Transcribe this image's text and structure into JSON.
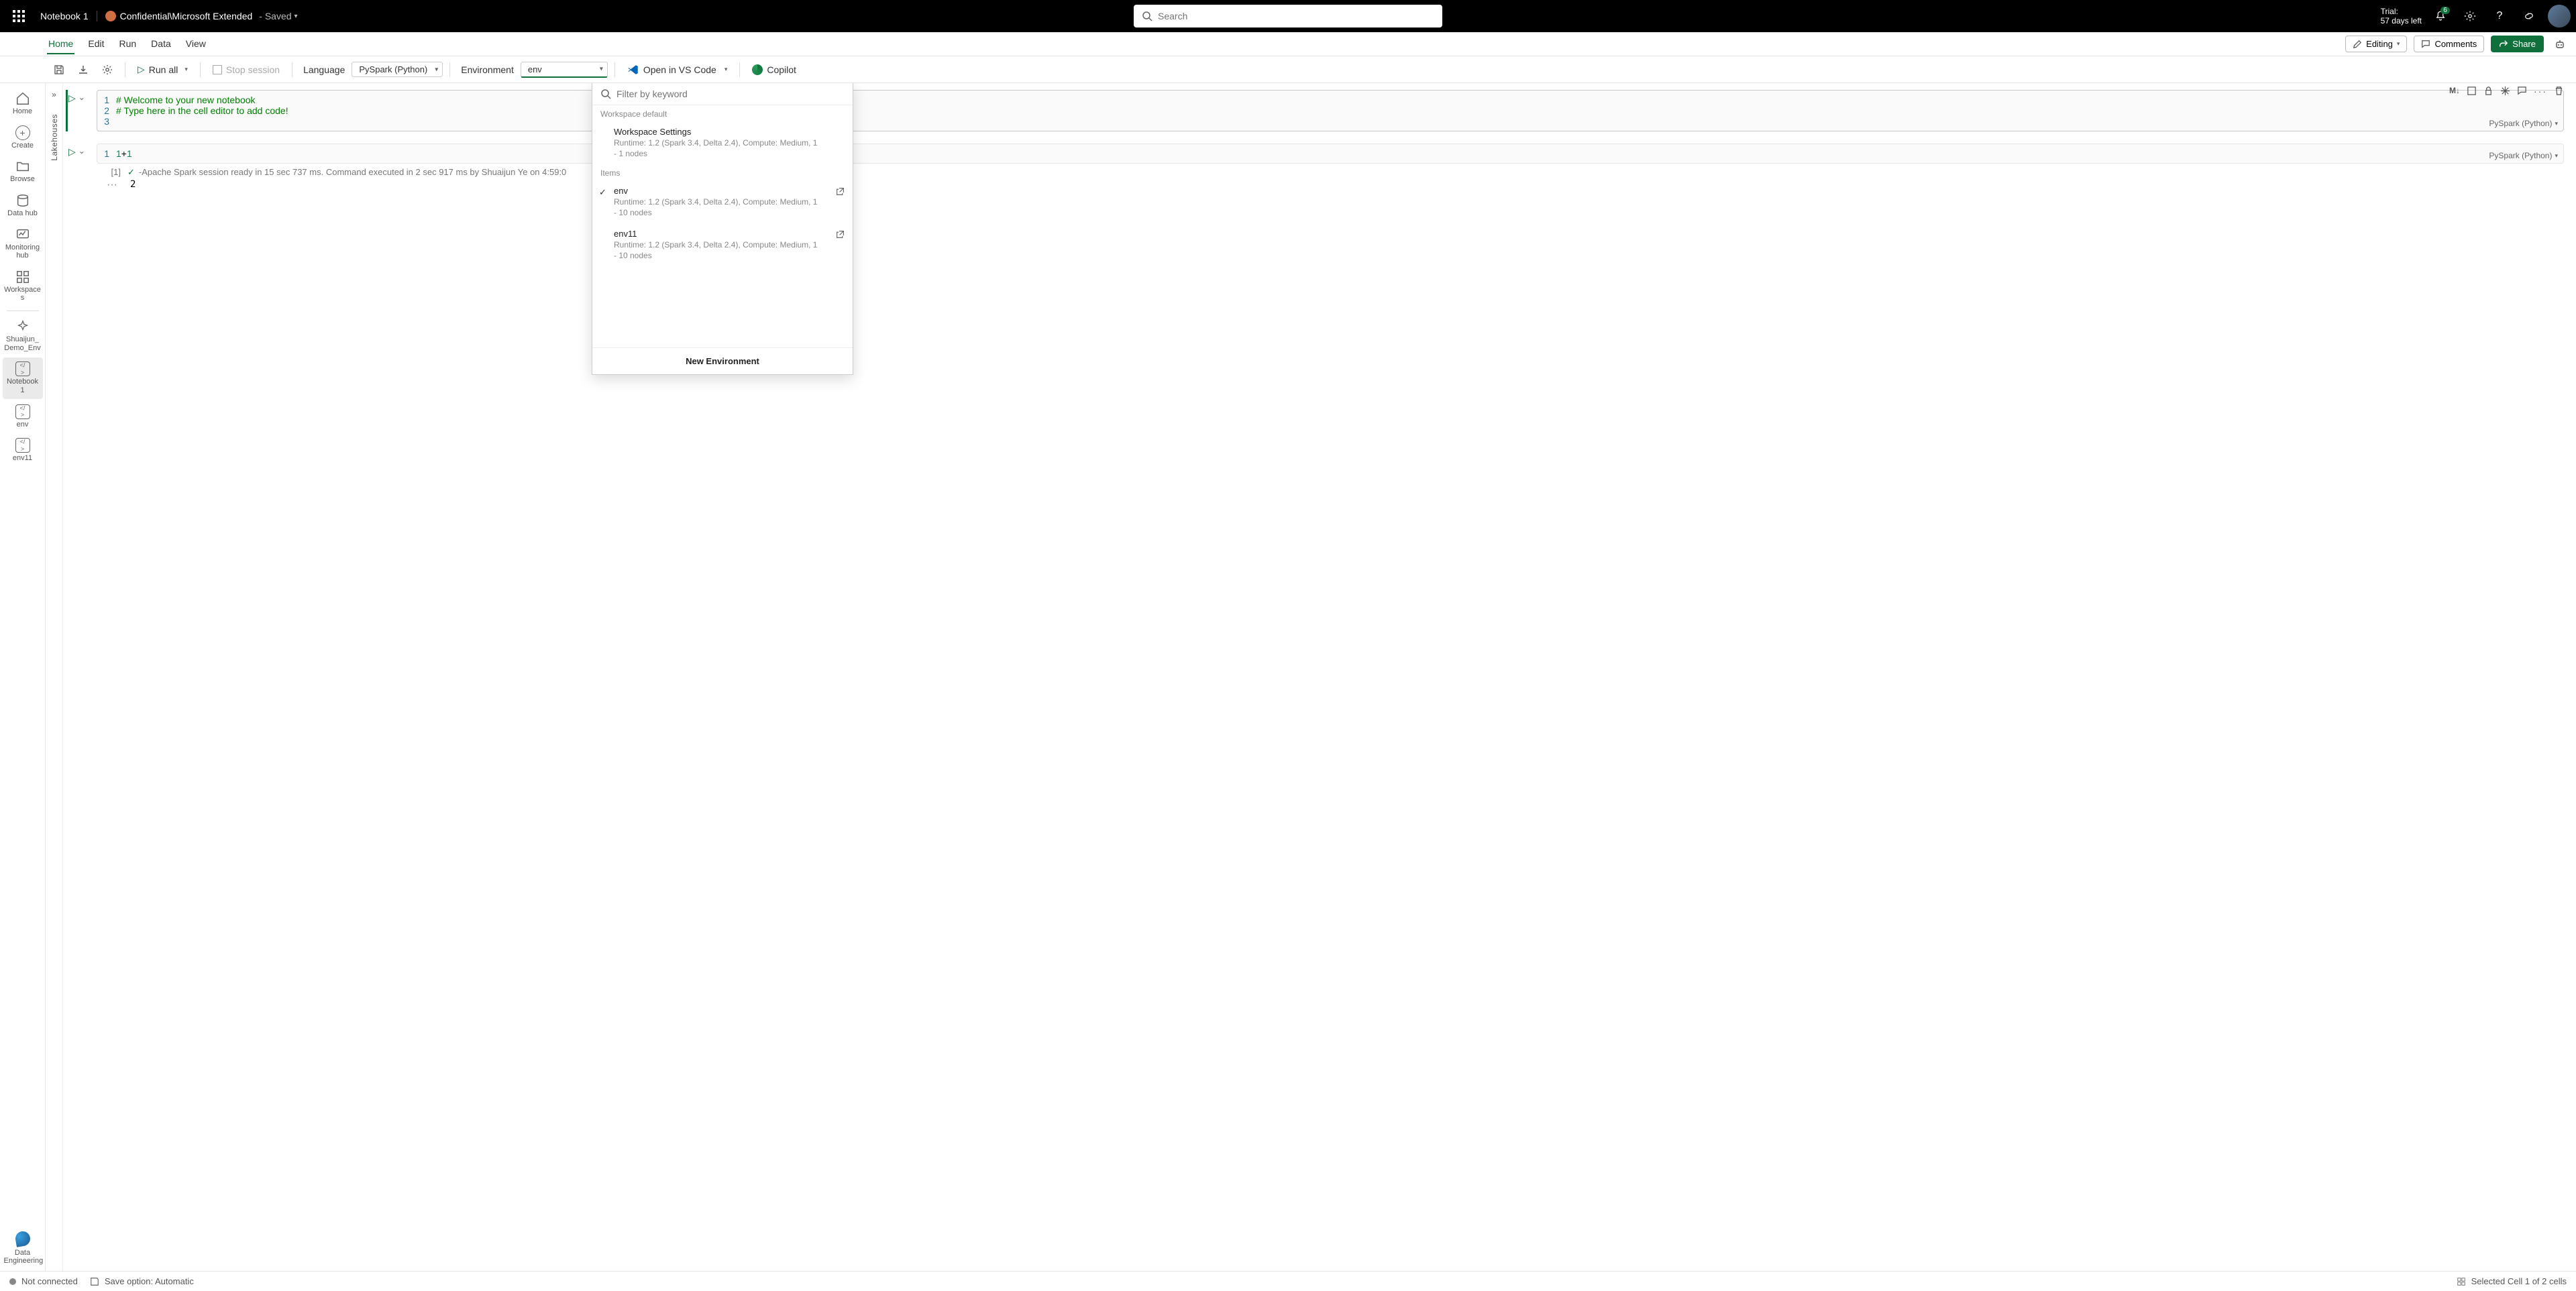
{
  "topbar": {
    "notebook_name": "Notebook 1",
    "sensitivity": "Confidential\\Microsoft Extended",
    "save_status": "- Saved",
    "search_placeholder": "Search",
    "trial_line1": "Trial:",
    "trial_line2": "57 days left",
    "notification_count": "6"
  },
  "ribbon": {
    "tabs": {
      "home": "Home",
      "edit": "Edit",
      "run": "Run",
      "data": "Data",
      "view": "View"
    },
    "editing": "Editing",
    "comments": "Comments",
    "share": "Share"
  },
  "toolbar": {
    "run_all": "Run all",
    "stop_session": "Stop session",
    "language_label": "Language",
    "language_value": "PySpark (Python)",
    "environment_label": "Environment",
    "environment_value": "env",
    "open_vscode": "Open in VS Code",
    "copilot": "Copilot"
  },
  "leftrail": {
    "home": "Home",
    "create": "Create",
    "browse": "Browse",
    "datahub": "Data hub",
    "monitoring": "Monitoring hub",
    "workspaces": "Workspaces",
    "shuaijun": "Shuaijun_Demo_Env",
    "notebook1": "Notebook 1",
    "env": "env",
    "env11": "env11",
    "persona": "Data Engineering"
  },
  "lakehouses_label": "Lakehouses",
  "cell_toolbar_md": "M↓",
  "cells": {
    "c1": {
      "l1": "# Welcome to your new notebook",
      "l2": "# Type here in the cell editor to add code!",
      "lang": "PySpark (Python)"
    },
    "c2": {
      "code": "1+1",
      "out_idx": "[1]",
      "status": "-Apache Spark session ready in 15 sec 737 ms. Command executed in 2 sec 917 ms by Shuaijun Ye on 4:59:0",
      "out_val": "2",
      "lang": "PySpark (Python)"
    }
  },
  "env_popover": {
    "filter_placeholder": "Filter by keyword",
    "section_default": "Workspace default",
    "ws_settings_title": "Workspace Settings",
    "ws_settings_sub": "Runtime: 1.2 (Spark 3.4, Delta 2.4), Compute: Medium, 1 - 1 nodes",
    "section_items": "Items",
    "env_title": "env",
    "env_sub": "Runtime: 1.2 (Spark 3.4, Delta 2.4), Compute: Medium, 1 - 10 nodes",
    "env11_title": "env11",
    "env11_sub": "Runtime: 1.2 (Spark 3.4, Delta 2.4), Compute: Medium, 1 - 10 nodes",
    "new_env": "New Environment"
  },
  "statusbar": {
    "not_connected": "Not connected",
    "save_option": "Save option: Automatic",
    "cell_info": "Selected Cell 1 of 2 cells"
  }
}
